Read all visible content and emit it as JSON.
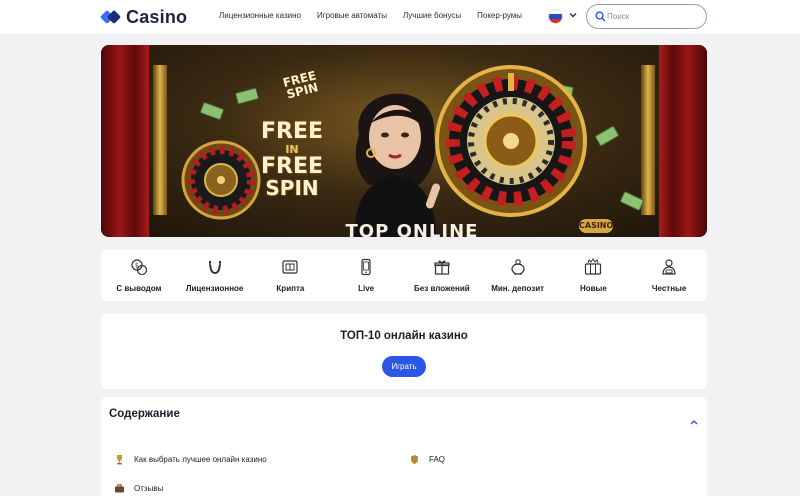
{
  "header": {
    "logo_text": "Casino",
    "nav": [
      {
        "label": "Лицензионные казино"
      },
      {
        "label": "Игровые автоматы"
      },
      {
        "label": "Лучшие бонусы"
      },
      {
        "label": "Покер-румы"
      }
    ],
    "language_flag": "russia-flag-icon",
    "search": {
      "placeholder": "Поиск",
      "value": ""
    }
  },
  "banner": {
    "free_spin_small_1": "FREE",
    "free_spin_small_2": "SPIN",
    "free_big_1": "FREE",
    "free_big_2": "IN",
    "free_big_3": "FREE",
    "free_big_4": "SPIN",
    "title_partial": "TOP ONLINE",
    "casino_sign": "CASINO"
  },
  "categories": [
    {
      "label": "С выводом",
      "icon": "coins-exchange-icon"
    },
    {
      "label": "Лицензионное",
      "icon": "horseshoe-icon"
    },
    {
      "label": "Крипта",
      "icon": "crypto-wallet-icon"
    },
    {
      "label": "Live",
      "icon": "mobile-live-icon"
    },
    {
      "label": "Без вложений",
      "icon": "gift-icon"
    },
    {
      "label": "Мин. депозит",
      "icon": "piggy-bank-icon"
    },
    {
      "label": "Новые",
      "icon": "new-slot-icon"
    },
    {
      "label": "Честные",
      "icon": "dealer-icon"
    }
  ],
  "top10": {
    "title": "ТОП-10 онлайн казино",
    "button": "Играть"
  },
  "toc": {
    "title": "Содержание",
    "items": [
      {
        "label": "Как выбрать лучшее онлайн казино",
        "icon": "trophy-icon"
      },
      {
        "label": "FAQ",
        "icon": "shield-icon"
      },
      {
        "label": "Отзывы",
        "icon": "briefcase-icon"
      }
    ]
  },
  "colors": {
    "accent": "#2b56e6",
    "page_bg": "#f2f2f4",
    "text": "#1b1d29"
  }
}
